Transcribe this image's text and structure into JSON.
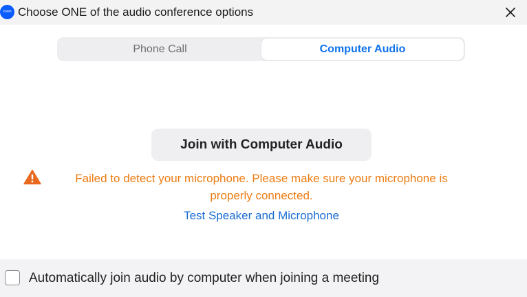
{
  "window": {
    "title": "Choose ONE of the audio conference options",
    "logo_text": "zoom"
  },
  "tabs": [
    {
      "label": "Phone Call",
      "selected": false
    },
    {
      "label": "Computer Audio",
      "selected": true
    }
  ],
  "main": {
    "join_button_label": "Join with Computer Audio",
    "warning_text": "Failed to detect your microphone. Please make sure your microphone is properly connected.",
    "test_link_label": "Test Speaker and Microphone"
  },
  "footer": {
    "auto_join_label": "Automatically join audio by computer when joining a meeting",
    "auto_join_checked": false
  },
  "colors": {
    "accent_blue": "#0e72ed",
    "warning_orange": "#ec7c12",
    "link_blue": "#1a6cd1",
    "logo_blue": "#0b5cff"
  },
  "icons": {
    "logo": "zoom-logo-icon",
    "close": "close-icon",
    "warning": "warning-triangle-icon"
  }
}
